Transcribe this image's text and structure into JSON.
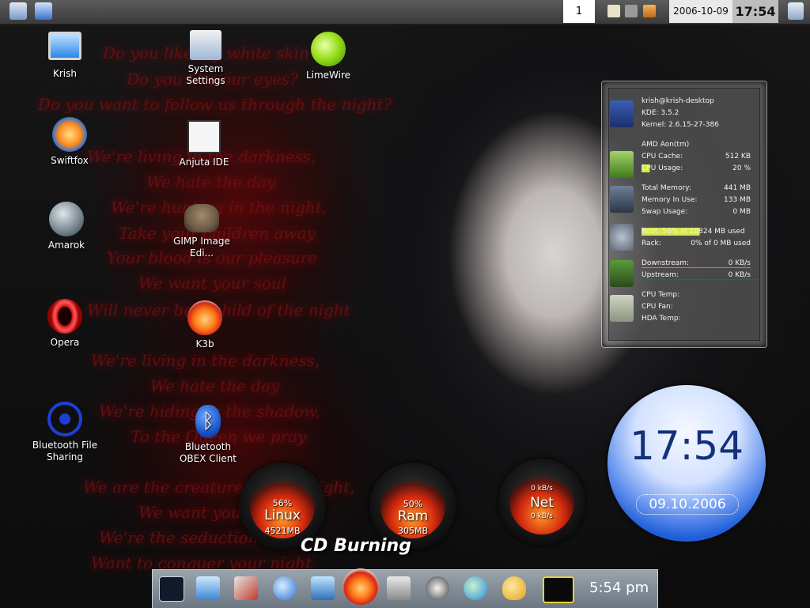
{
  "top_panel": {
    "pager_value": "1",
    "date": "2006-10-09",
    "time": "17:54",
    "left_icons": [
      "show-desktop-icon",
      "computer-icon"
    ],
    "tray_icons": [
      "clipboard-icon",
      "volume-icon",
      "update-icon"
    ],
    "trash_icon": "trash-icon"
  },
  "wallpaper_lyrics": [
    "Do you like my white skin",
    "Do you like our eyes?",
    "Do you want to follow us through the night?",
    "We're living in the darkness,",
    "We hate the day",
    "We're hunting in the night,",
    "Take your children away",
    "Your blood is our pleasure",
    "We want your soul",
    "Will never be a child of the night",
    "We're living in the darkness,",
    "We hate the day",
    "We're hiding in the shadow,",
    "To the Queen we pray",
    "We are the creatures of the night,",
    "We want you",
    "We're the seduction",
    "Want to conquer your night"
  ],
  "desktop_icons": [
    {
      "label": "Krish",
      "icon": "monitor-icon"
    },
    {
      "label": "System Settings",
      "icon": "settings-icon"
    },
    {
      "label": "LimeWire",
      "icon": "lime-icon"
    },
    {
      "label": "Swiftfox",
      "icon": "swiftfox-icon"
    },
    {
      "label": "Anjuta IDE",
      "icon": "anjuta-icon"
    },
    {
      "label": "Amarok",
      "icon": "amarok-icon"
    },
    {
      "label": "GIMP Image Edi...",
      "icon": "gimp-icon"
    },
    {
      "label": "Opera",
      "icon": "opera-icon"
    },
    {
      "label": "K3b",
      "icon": "k3b-icon"
    },
    {
      "label": "Bluetooth File Sharing",
      "icon": "bluetooth-icon"
    },
    {
      "label": "Bluetooth OBEX Client",
      "icon": "bluetooth-obex-icon"
    }
  ],
  "sysinfo": {
    "user": "krish@krish-desktop",
    "kde": "KDE: 3.5.2",
    "kernel": "Kernel:  2.6.15-27-386",
    "cpu_name": "AMD Aon(tm)",
    "cpu_cache_label": "CPU Cache:",
    "cpu_cache": "512 KB",
    "cpu_usage_label": "CPU Usage:",
    "cpu_usage": "20 %",
    "total_mem_label": "Total Memory:",
    "total_mem": "441 MB",
    "mem_used_label": "Memory In Use:",
    "mem_used": "133 MB",
    "swap_label": "Swap Usage:",
    "swap": "0 MB",
    "root_label": "Root: 56% of 10824 MB used",
    "rack_label": "Rack:",
    "rack": "0% of 0 MB used",
    "down_label": "Downstream:",
    "down": "0 KB/s",
    "up_label": "Upstream:",
    "up": "0 KB/s",
    "cpu_temp_label": "CPU Temp:",
    "cpu_fan_label": "CPU Fan:",
    "hda_temp_label": "HDA Temp:"
  },
  "clock_widget": {
    "time": "17:54",
    "date": "09.10.2006"
  },
  "gauges": [
    {
      "top": "56%",
      "label": "Linux",
      "bottom": "4521MB"
    },
    {
      "top": "50%",
      "label": "Ram",
      "bottom": "305MB"
    },
    {
      "top": "0 kB/s",
      "label": "Net",
      "bottom": "0 kB/s"
    }
  ],
  "tooltip": "CD Burning",
  "dock": {
    "items": [
      "terminal-icon",
      "monitor-icon",
      "tools-icon",
      "browser-icon",
      "screen-icon",
      "k3b-icon",
      "display-icon",
      "settings-wheel-icon",
      "users-icon",
      "paint-icon",
      "ksysguard-icon"
    ],
    "time": "5:54 pm"
  }
}
